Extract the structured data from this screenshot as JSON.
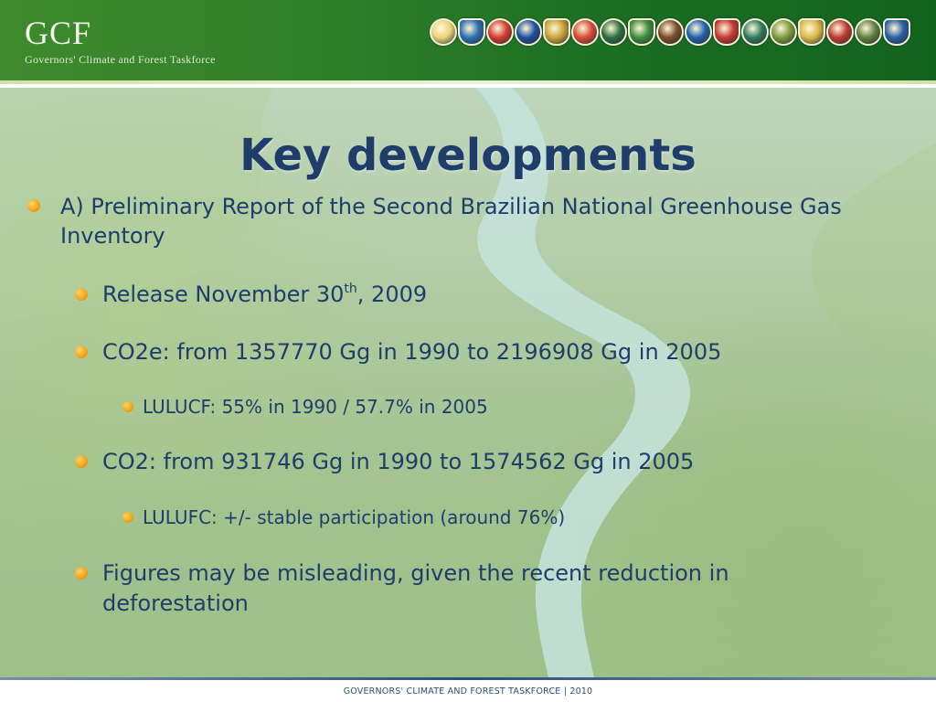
{
  "header": {
    "logo_title": "GCF",
    "logo_subtitle": "Governors' Climate and Forest Taskforce",
    "seal_count": 17,
    "seal_colors": [
      "#e8d57a",
      "#2f6fb2",
      "#d13b2f",
      "#1e4f9c",
      "#c9a33a",
      "#d74a36",
      "#2c6e3f",
      "#3f8d3c",
      "#7a4b2a",
      "#1f5fa8",
      "#c33a32",
      "#2f7b5c",
      "#7c9a3a",
      "#d8b94a",
      "#b93c31",
      "#5f7f3f",
      "#2b5fa4"
    ]
  },
  "slide": {
    "title": "Key developments",
    "bullets": {
      "a": "A) Preliminary Report of the Second Brazilian National Greenhouse Gas Inventory",
      "release_prefix": "Release November 30",
      "release_sup": "th",
      "release_suffix": ", 2009",
      "co2e": "CO2e: from 1357770 Gg in 1990 to 2196908 Gg in 2005",
      "lulucf": "LULUCF: 55% in 1990 / 57.7% in 2005",
      "co2": "CO2: from 931746 Gg in 1990 to 1574562 Gg in 2005",
      "lulufc": "LULUFC: +/- stable participation (around 76%)",
      "figures": "Figures may be misleading, given the recent reduction in deforestation"
    }
  },
  "footer": {
    "text": "GOVERNORS' CLIMATE AND FOREST TASKFORCE | 2010"
  },
  "colors": {
    "title": "#1f3d6b",
    "bullet": "#f0a21a",
    "header_green": "#1c6e22"
  }
}
